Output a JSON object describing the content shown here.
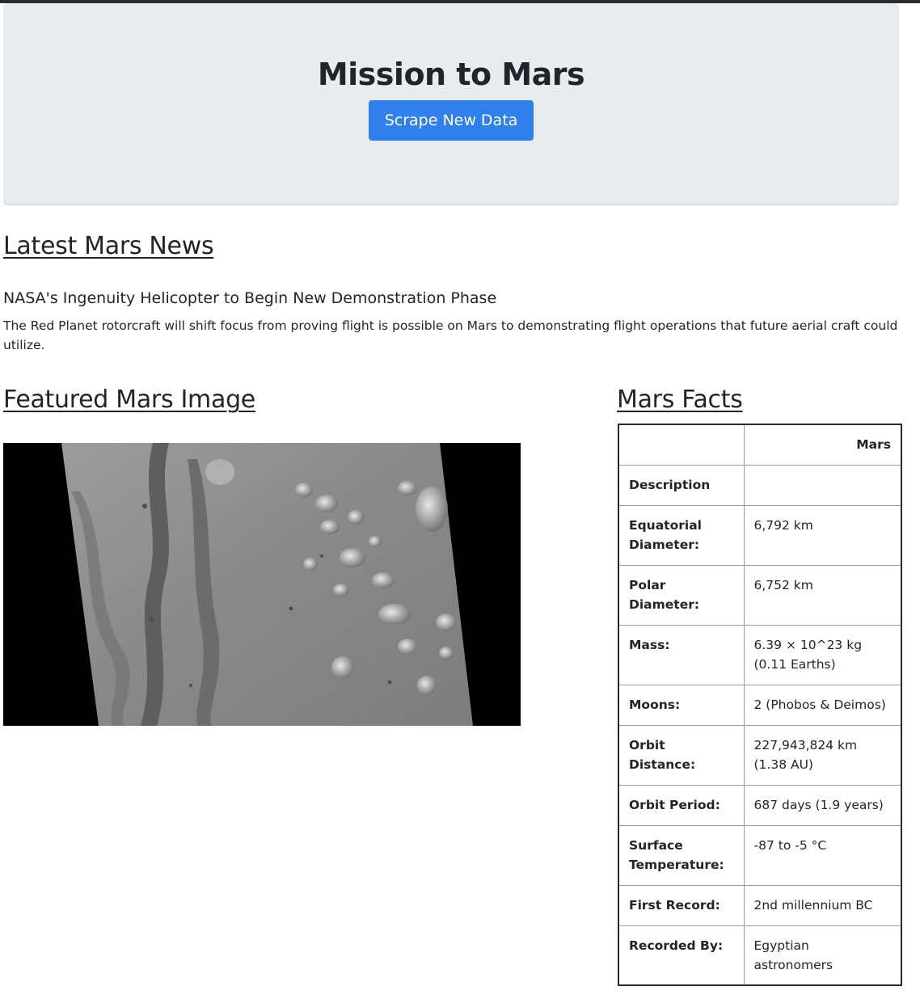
{
  "header": {
    "title": "Mission to Mars",
    "scrape_button": "Scrape New Data"
  },
  "news": {
    "section_title": "Latest Mars News",
    "headline": "NASA's Ingenuity Helicopter to Begin New Demonstration Phase",
    "paragraph": "The Red Planet rotorcraft will shift focus from proving flight is possible on Mars to demonstrating flight operations that future aerial craft could utilize."
  },
  "featured": {
    "section_title": "Featured Mars Image"
  },
  "facts": {
    "section_title": "Mars Facts",
    "column_header": "Mars",
    "rows": [
      {
        "label": "Description",
        "value": ""
      },
      {
        "label": "Equatorial Diameter:",
        "value": "6,792 km"
      },
      {
        "label": "Polar Diameter:",
        "value": "6,752 km"
      },
      {
        "label": "Mass:",
        "value": "6.39 × 10^23 kg (0.11 Earths)"
      },
      {
        "label": "Moons:",
        "value": "2 (Phobos & Deimos)"
      },
      {
        "label": "Orbit Distance:",
        "value": "227,943,824 km (1.38 AU)"
      },
      {
        "label": "Orbit Period:",
        "value": "687 days (1.9 years)"
      },
      {
        "label": "Surface Temperature:",
        "value": "-87 to -5 °C"
      },
      {
        "label": "First Record:",
        "value": "2nd millennium BC"
      },
      {
        "label": "Recorded By:",
        "value": "Egyptian astronomers"
      }
    ]
  },
  "colors": {
    "jumbotron_bg": "#e9ecef",
    "button_primary": "#2f80ed"
  }
}
